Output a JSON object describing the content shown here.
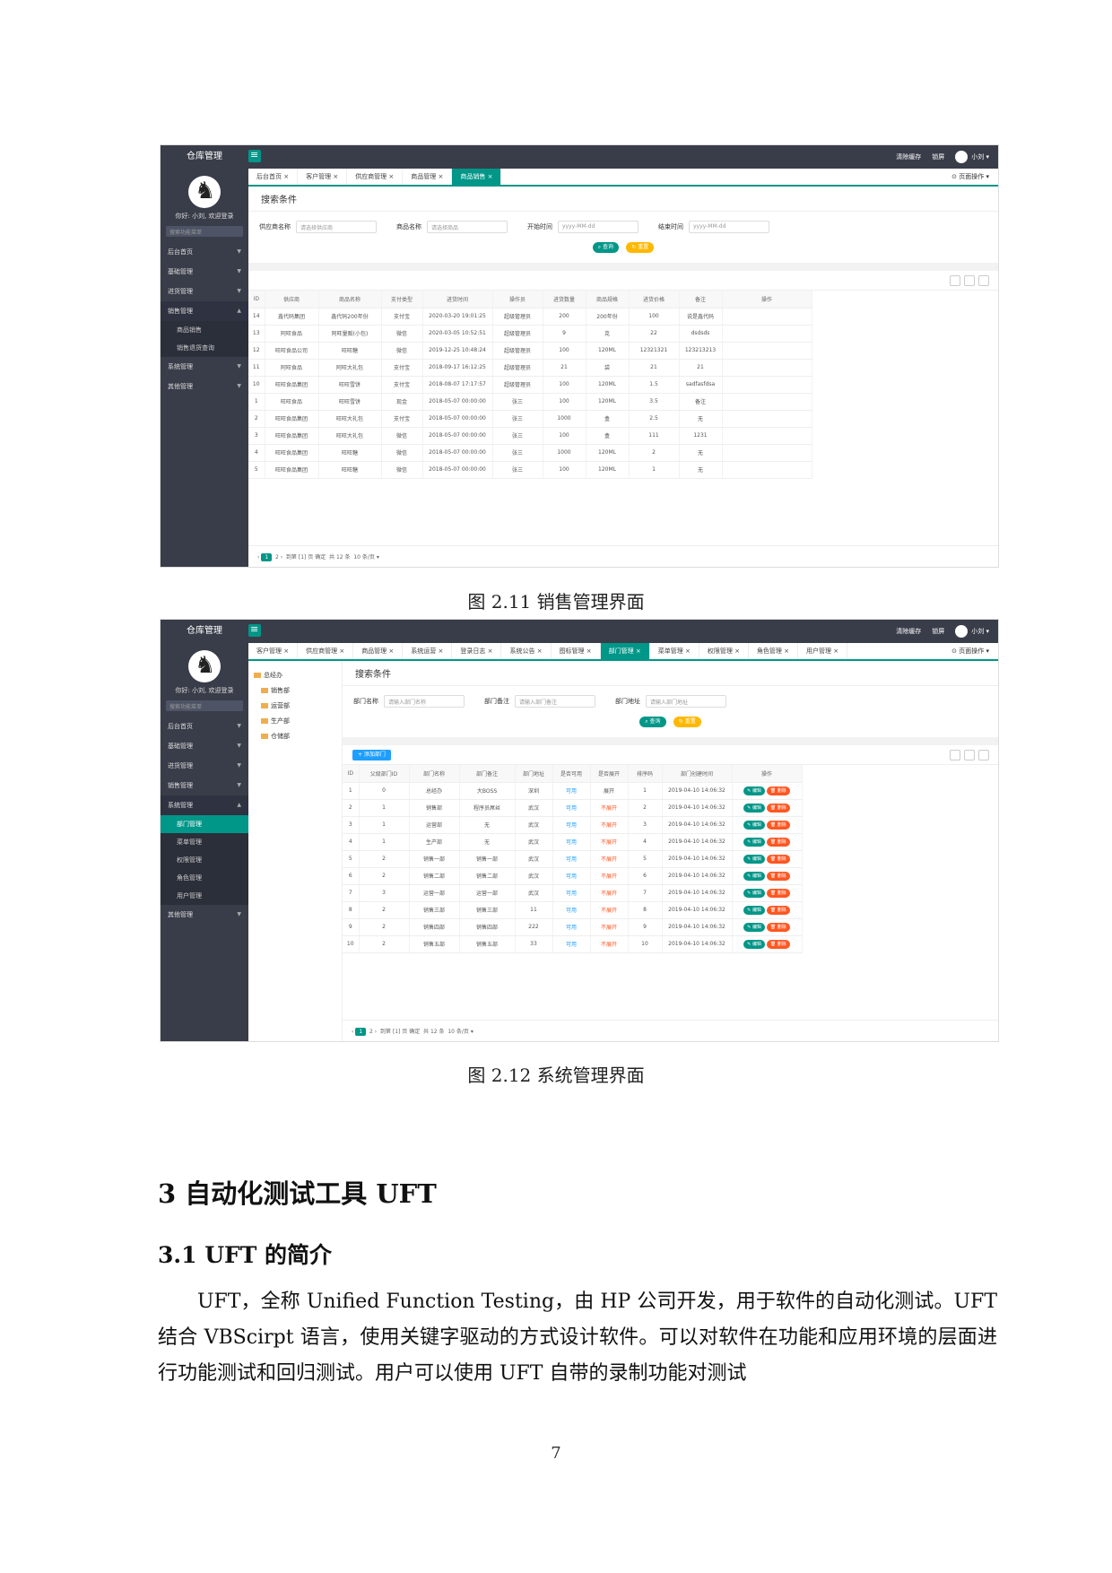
{
  "app": {
    "title": "仓库管理",
    "top_items": [
      "清除缓存",
      "锁屏",
      "小刘"
    ],
    "user": "你好: 小刘, 欢迎登录",
    "search_placeholder": "搜索功能菜单",
    "tab_options": "页面操作"
  },
  "shot1": {
    "sidebar": [
      {
        "label": "后台首页",
        "type": "item"
      },
      {
        "label": "基础管理",
        "type": "item"
      },
      {
        "label": "进货管理",
        "type": "item"
      },
      {
        "label": "销售管理",
        "type": "open"
      },
      {
        "label": "商品销售",
        "type": "sub"
      },
      {
        "label": "销售退货查询",
        "type": "sub"
      },
      {
        "label": "系统管理",
        "type": "item"
      },
      {
        "label": "其他管理",
        "type": "item"
      }
    ],
    "tabs": [
      "后台首页",
      "客户管理",
      "供应商管理",
      "商品管理",
      "商品销售"
    ],
    "active_tab": 4,
    "search_title": "搜索条件",
    "fields": [
      {
        "label": "供应商名称",
        "value": "请选择供应商"
      },
      {
        "label": "商品名称",
        "value": "请选择商品"
      },
      {
        "label": "开始时间",
        "value": "yyyy-MM-dd"
      },
      {
        "label": "结束时间",
        "value": "yyyy-MM-dd"
      }
    ],
    "btn_query": "查询",
    "btn_reset": "重置",
    "columns": [
      "ID",
      "供应商",
      "商品名称",
      "支付类型",
      "进货时间",
      "操作员",
      "进货数量",
      "商品规格",
      "进货价格",
      "备注",
      "操作"
    ],
    "rows": [
      [
        "14",
        "鑫代码集团",
        "鑫代码200年份",
        "支付宝",
        "2020-03-20 19:01:25",
        "超级管理员",
        "200",
        "200年份",
        "100",
        "说是鑫代码",
        ""
      ],
      [
        "13",
        "阿旺食品",
        "阿旺量贩(小包)",
        "微信",
        "2020-03-05 10:52:51",
        "超级管理员",
        "9",
        "克",
        "22",
        "dsdsds",
        ""
      ],
      [
        "12",
        "旺旺食品公司",
        "旺旺糖",
        "微信",
        "2019-12-25 10:48:24",
        "超级管理员",
        "100",
        "120ML",
        "12321321",
        "123213213",
        ""
      ],
      [
        "11",
        "阿旺食品",
        "阿旺大礼包",
        "支付宝",
        "2018-09-17 16:12:25",
        "超级管理员",
        "21",
        "袋",
        "21",
        "21",
        ""
      ],
      [
        "10",
        "旺旺食品集团",
        "旺旺雪饼",
        "支付宝",
        "2018-08-07 17:17:57",
        "超级管理员",
        "100",
        "120ML",
        "1.5",
        "sadfasfdsa",
        ""
      ],
      [
        "1",
        "旺旺食品",
        "旺旺雪饼",
        "现金",
        "2018-05-07 00:00:00",
        "张三",
        "100",
        "120ML",
        "3.5",
        "备注",
        ""
      ],
      [
        "2",
        "旺旺食品集团",
        "旺旺大礼包",
        "支付宝",
        "2018-05-07 00:00:00",
        "张三",
        "1000",
        "盒",
        "2.5",
        "无",
        ""
      ],
      [
        "3",
        "旺旺食品集团",
        "旺旺大礼包",
        "微信",
        "2018-05-07 00:00:00",
        "张三",
        "100",
        "盒",
        "111",
        "1231",
        ""
      ],
      [
        "4",
        "旺旺食品集团",
        "旺旺糖",
        "微信",
        "2018-05-07 00:00:00",
        "张三",
        "1000",
        "120ML",
        "2",
        "无",
        ""
      ],
      [
        "5",
        "旺旺食品集团",
        "旺旺糖",
        "微信",
        "2018-05-07 00:00:00",
        "张三",
        "100",
        "120ML",
        "1",
        "无",
        ""
      ]
    ],
    "pager": {
      "current": "1",
      "next": "2",
      "goto": "到第",
      "page": "1",
      "unit": "页",
      "confirm": "确定",
      "total": "共 12 条",
      "per": "10 条/页"
    }
  },
  "caption1": "图 2.11 销售管理界面",
  "shot2": {
    "sidebar": [
      {
        "label": "后台首页",
        "type": "item"
      },
      {
        "label": "基础管理",
        "type": "item"
      },
      {
        "label": "进货管理",
        "type": "item"
      },
      {
        "label": "销售管理",
        "type": "item"
      },
      {
        "label": "系统管理",
        "type": "open"
      },
      {
        "label": "部门管理",
        "type": "subact"
      },
      {
        "label": "菜单管理",
        "type": "sub"
      },
      {
        "label": "权限管理",
        "type": "sub"
      },
      {
        "label": "角色管理",
        "type": "sub"
      },
      {
        "label": "用户管理",
        "type": "sub"
      },
      {
        "label": "其他管理",
        "type": "item"
      }
    ],
    "tabs": [
      "客户管理",
      "供应商管理",
      "商品管理",
      "系统运营",
      "登录日志",
      "系统公告",
      "图标管理",
      "部门管理",
      "菜单管理",
      "权限管理",
      "角色管理",
      "用户管理"
    ],
    "active_tab": 7,
    "tree": [
      "总经办",
      "销售部",
      "运营部",
      "生产部",
      "仓储部"
    ],
    "search_title": "搜索条件",
    "fields": [
      {
        "label": "部门名称",
        "value": "请输入部门名称"
      },
      {
        "label": "部门备注",
        "value": "请输入部门备注"
      },
      {
        "label": "部门地址",
        "value": "请输入部门地址"
      }
    ],
    "btn_query": "查询",
    "btn_reset": "重置",
    "btn_add": "+ 添加部门",
    "columns": [
      "ID",
      "父级部门ID",
      "部门名称",
      "部门备注",
      "部门地址",
      "是否可用",
      "是否展开",
      "排序码",
      "部门创建时间",
      "操作"
    ],
    "rows": [
      [
        "1",
        "0",
        "总经办",
        "大BOSS",
        "深圳",
        "可用",
        "展开",
        "1",
        "2019-04-10 14:06:32"
      ],
      [
        "2",
        "1",
        "销售部",
        "程序员屌丝",
        "武汉",
        "可用",
        "不展开",
        "2",
        "2019-04-10 14:06:32"
      ],
      [
        "3",
        "1",
        "运营部",
        "无",
        "武汉",
        "可用",
        "不展开",
        "3",
        "2019-04-10 14:06:32"
      ],
      [
        "4",
        "1",
        "生产部",
        "无",
        "武汉",
        "可用",
        "不展开",
        "4",
        "2019-04-10 14:06:32"
      ],
      [
        "5",
        "2",
        "销售一部",
        "销售一部",
        "武汉",
        "可用",
        "不展开",
        "5",
        "2019-04-10 14:06:32"
      ],
      [
        "6",
        "2",
        "销售二部",
        "销售二部",
        "武汉",
        "可用",
        "不展开",
        "6",
        "2019-04-10 14:06:32"
      ],
      [
        "7",
        "3",
        "运营一部",
        "运营一部",
        "武汉",
        "可用",
        "不展开",
        "7",
        "2019-04-10 14:06:32"
      ],
      [
        "8",
        "2",
        "销售三部",
        "销售三部",
        "11",
        "可用",
        "不展开",
        "8",
        "2019-04-10 14:06:32"
      ],
      [
        "9",
        "2",
        "销售四部",
        "销售四部",
        "222",
        "可用",
        "不展开",
        "9",
        "2019-04-10 14:06:32"
      ],
      [
        "10",
        "2",
        "销售五部",
        "销售五部",
        "33",
        "可用",
        "不展开",
        "10",
        "2019-04-10 14:06:32"
      ]
    ],
    "op_edit": "编辑",
    "op_del": "删除",
    "pager": {
      "current": "1",
      "next": "2",
      "goto": "到第",
      "page": "1",
      "unit": "页",
      "confirm": "确定",
      "total": "共 12 条",
      "per": "10 条/页"
    }
  },
  "caption2": "图 2.12 系统管理界面",
  "heading1": "3 自动化测试工具 UFT",
  "heading2": "3.1 UFT 的简介",
  "paragraph": "UFT，全称 Unified Function Testing，由 HP 公司开发，用于软件的自动化测试。UFT 结合 VBScirpt 语言，使用关键字驱动的方式设计软件。可以对软件在功能和应用环境的层面进行功能测试和回归测试。用户可以使用 UFT 自带的录制功能对测试",
  "page_number": "7"
}
